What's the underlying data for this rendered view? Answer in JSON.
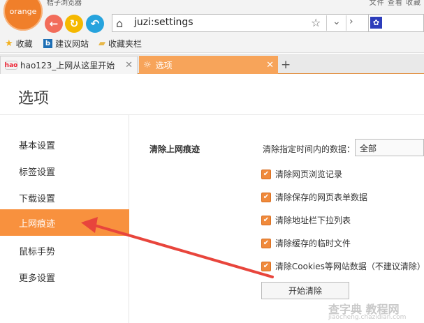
{
  "app": {
    "logo_text": "orange",
    "name": "桔子浏览器",
    "window_menu": "文件  查看  收藏"
  },
  "toolbar": {
    "url": "juzi:settings"
  },
  "bookmarks": [
    {
      "icon": "star-icon",
      "label": "收藏"
    },
    {
      "icon": "bing-icon",
      "label": "建议网站"
    },
    {
      "icon": "folder-icon",
      "label": "收藏夹栏"
    }
  ],
  "tabs": [
    {
      "label": "hao123_上网从这里开始",
      "active": false
    },
    {
      "label": "选项",
      "active": true
    }
  ],
  "page": {
    "title": "选项"
  },
  "sidebar": {
    "items": [
      {
        "label": "基本设置"
      },
      {
        "label": "标签设置"
      },
      {
        "label": "下载设置"
      },
      {
        "label": "上网痕迹"
      },
      {
        "label": "鼠标手势"
      },
      {
        "label": "更多设置"
      }
    ]
  },
  "content": {
    "section_label": "清除上网痕迹",
    "range_label": "清除指定时间内的数据：",
    "range_value": "全部",
    "checkboxes": [
      {
        "label": "清除网页浏览记录",
        "checked": true
      },
      {
        "label": "清除保存的网页表单数据",
        "checked": true
      },
      {
        "label": "清除地址栏下拉列表",
        "checked": true
      },
      {
        "label": "清除缓存的临时文件",
        "checked": true
      },
      {
        "label": "清除Cookies等网站数据（不建议清除）",
        "checked": true
      }
    ],
    "start_button": "开始清除"
  },
  "watermark": {
    "line1": "查字典 教程网",
    "line2": "jiaocheng.chazidian.com"
  },
  "colors": {
    "accent": "#f8913e",
    "annotation_arrow": "#e8453c"
  }
}
